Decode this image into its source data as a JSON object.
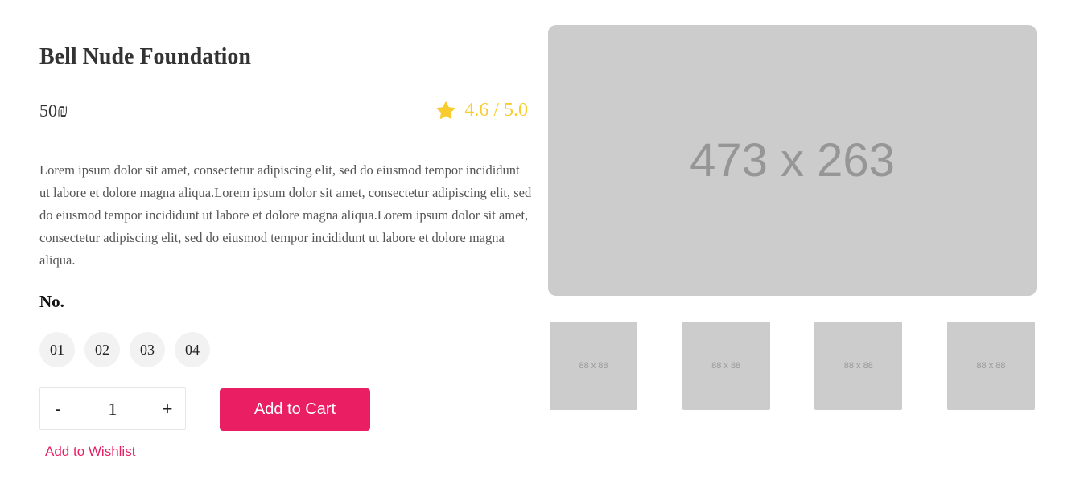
{
  "product": {
    "title": "Bell Nude Foundation",
    "price": "50₪",
    "rating": {
      "text": "4.6 / 5.0",
      "icon": "star-icon",
      "color": "#f8cc2c"
    },
    "description": "Lorem ipsum dolor sit amet, consectetur adipiscing elit, sed do eiusmod tempor incididunt ut labore et dolore magna aliqua.Lorem ipsum dolor sit amet, consectetur adipiscing elit, sed do eiusmod tempor incididunt ut labore et dolore magna aliqua.Lorem ipsum dolor sit amet, consectetur adipiscing elit, sed do eiusmod tempor incididunt ut labore et dolore magna aliqua."
  },
  "variants": {
    "heading": "No.",
    "options": [
      "01",
      "02",
      "03",
      "04"
    ]
  },
  "quantity": {
    "decrement": "-",
    "value": "1",
    "increment": "+"
  },
  "actions": {
    "add_to_cart": "Add to Cart",
    "add_to_wishlist": "Add to Wishlist",
    "accent_color": "#e91e63"
  },
  "gallery": {
    "main_label": "473 x 263",
    "thumbnails": [
      "88 x 88",
      "88 x 88",
      "88 x 88",
      "88 x 88"
    ]
  }
}
